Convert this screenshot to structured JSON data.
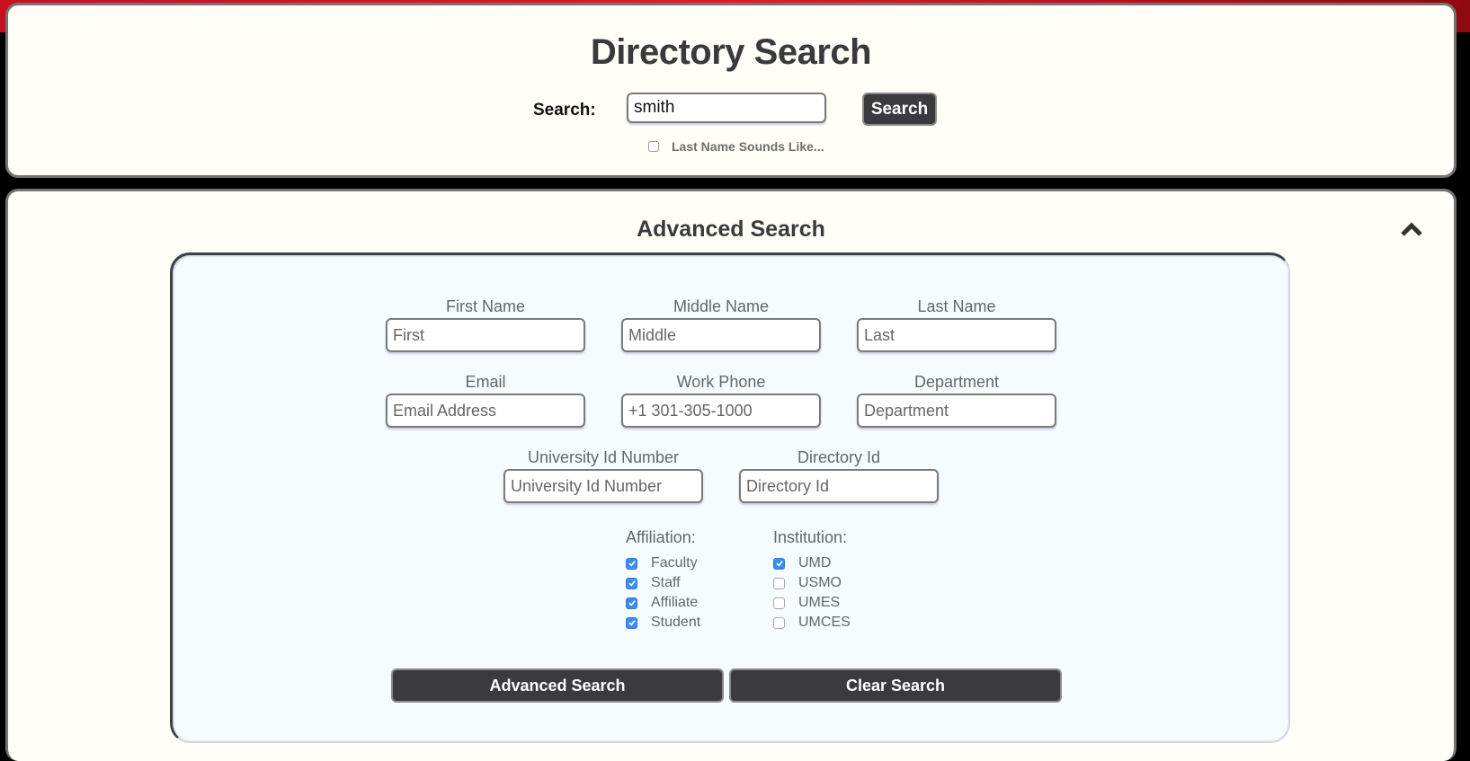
{
  "header": {
    "title": "Directory Search",
    "search_label": "Search:",
    "search_value": "smith",
    "search_button": "Search",
    "sounds_like_label": "Last Name Sounds Like...",
    "sounds_like_checked": false
  },
  "advanced": {
    "heading": "Advanced Search",
    "collapse_icon": "chevron-up-icon",
    "fields": [
      {
        "label": "First Name",
        "placeholder": "First",
        "value": ""
      },
      {
        "label": "Middle Name",
        "placeholder": "Middle",
        "value": ""
      },
      {
        "label": "Last Name",
        "placeholder": "Last",
        "value": ""
      },
      {
        "label": "Email",
        "placeholder": "Email Address",
        "value": ""
      },
      {
        "label": "Work Phone",
        "placeholder": "+1 301-305-1000",
        "value": ""
      },
      {
        "label": "Department",
        "placeholder": "Department",
        "value": ""
      },
      {
        "label": "University Id Number",
        "placeholder": "University Id Number",
        "value": ""
      },
      {
        "label": "Directory Id",
        "placeholder": "Directory Id",
        "value": ""
      }
    ],
    "affiliation": {
      "title": "Affiliation:",
      "options": [
        {
          "label": "Faculty",
          "checked": true
        },
        {
          "label": "Staff",
          "checked": true
        },
        {
          "label": "Affiliate",
          "checked": true
        },
        {
          "label": "Student",
          "checked": true
        }
      ]
    },
    "institution": {
      "title": "Institution:",
      "options": [
        {
          "label": "UMD",
          "checked": true
        },
        {
          "label": "USMO",
          "checked": false
        },
        {
          "label": "UMES",
          "checked": false
        },
        {
          "label": "UMCES",
          "checked": false
        }
      ]
    },
    "advanced_search_button": "Advanced Search",
    "clear_search_button": "Clear Search"
  },
  "colors": {
    "brand_red": "#e31b23",
    "panel_bg": "#fffff7",
    "button_dark": "#3b3a3f",
    "checkbox_blue": "#3b8ef0"
  }
}
